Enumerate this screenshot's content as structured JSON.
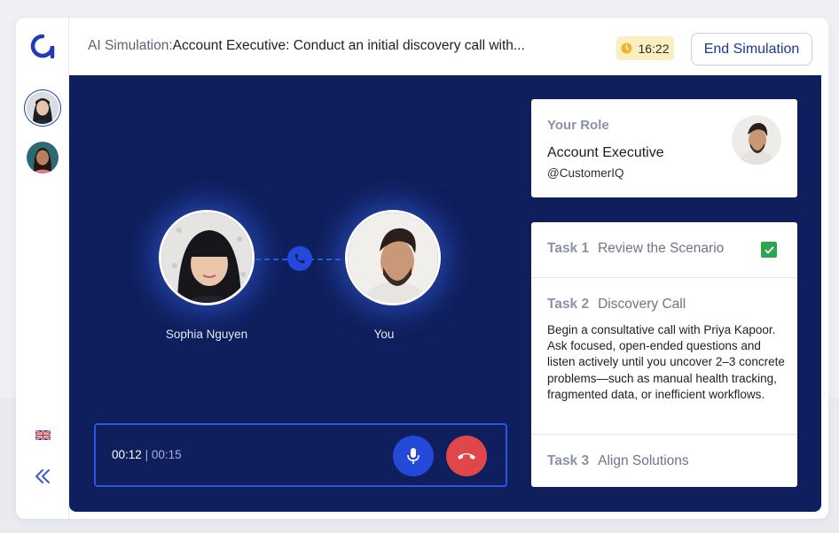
{
  "header": {
    "title_prefix": "AI Simulation:",
    "title": "Account Executive: Conduct an initial discovery call with...",
    "timer": "16:22",
    "end_button": "End Simulation"
  },
  "sidebar": {
    "logo": "app-logo",
    "avatars": [
      "Sophia Nguyen",
      "Priya Kapoor"
    ],
    "language_flag": "uk-flag-icon",
    "collapse_icon": "double-chevron-left-icon"
  },
  "call": {
    "caller_name": "Sophia Nguyen",
    "self_name": "You",
    "elapsed": "00:12",
    "separator": "|",
    "total": "00:15"
  },
  "role": {
    "label": "Your Role",
    "title": "Account Executive",
    "org": "@CustomerIQ"
  },
  "tasks": [
    {
      "number": "Task 1",
      "name": "Review the Scenario",
      "completed": true
    },
    {
      "number": "Task 2",
      "name": "Discovery Call",
      "description": "Begin a consultative call with Priya Kapoor. Ask focused, open-ended questions and listen actively until you uncover 2–3 concrete problems—such as manual health tracking, fragmented data, or inefficient workflows."
    },
    {
      "number": "Task 3",
      "name": "Align Solutions"
    }
  ],
  "colors": {
    "panel_bg": "#0f1e5c",
    "accent": "#2449d8",
    "hangup": "#e0474b",
    "timer_bg": "#fdeec2",
    "check": "#2ea44f"
  }
}
